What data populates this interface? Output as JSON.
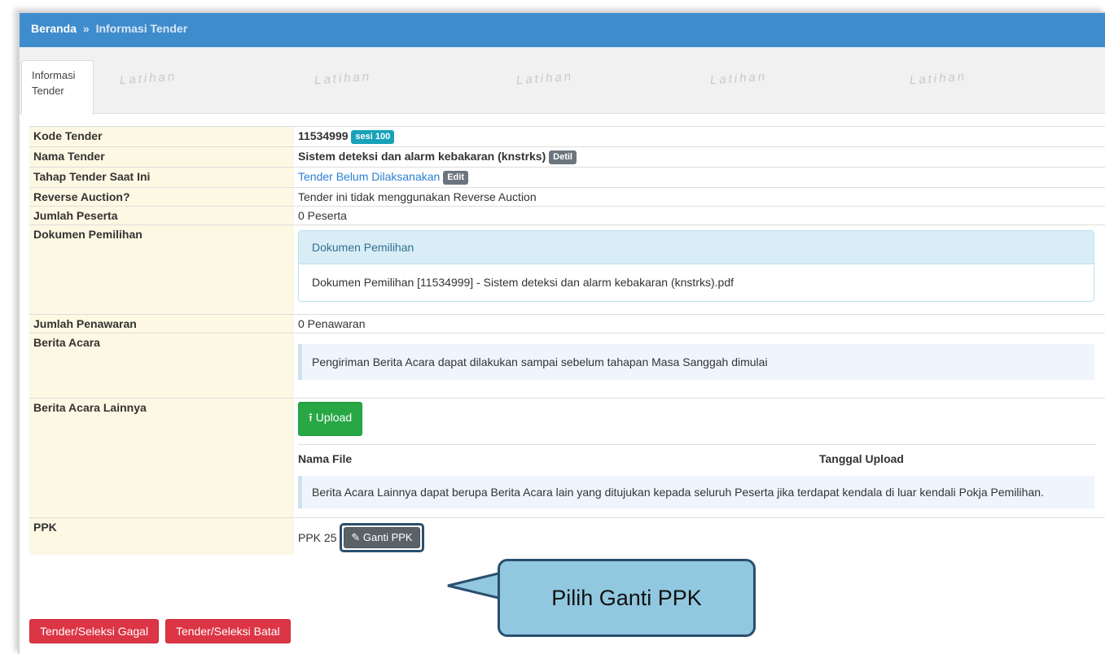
{
  "breadcrumb": {
    "home": "Beranda",
    "separator": "»",
    "current": "Informasi Tender"
  },
  "tabs": [
    {
      "label_line1": "Informasi",
      "label_line2": "Tender"
    }
  ],
  "watermark": "Latihan",
  "rows": {
    "kode": {
      "label": "Kode Tender",
      "value": "11534999",
      "badge": "sesi 100"
    },
    "nama": {
      "label": "Nama Tender",
      "value": "Sistem deteksi dan alarm kebakaran (knstrks)",
      "badge": "Detil"
    },
    "tahap": {
      "label": "Tahap Tender Saat Ini",
      "value": "Tender Belum Dilaksanakan",
      "badge": "Edit"
    },
    "reverse": {
      "label": "Reverse Auction?",
      "value": "Tender ini tidak menggunakan Reverse Auction"
    },
    "peserta": {
      "label": "Jumlah Peserta",
      "value": "0 Peserta"
    },
    "dokumen": {
      "label": "Dokumen Pemilihan",
      "panel_title": "Dokumen Pemilihan",
      "file": "Dokumen Pemilihan [11534999] - Sistem deteksi dan alarm kebakaran (knstrks).pdf"
    },
    "penawaran": {
      "label": "Jumlah Penawaran",
      "value": "0 Penawaran"
    },
    "berita": {
      "label": "Berita Acara",
      "note": "Pengiriman Berita Acara dapat dilakukan sampai sebelum tahapan Masa Sanggah dimulai"
    },
    "lainnya": {
      "label": "Berita Acara Lainnya",
      "upload_label": "Upload",
      "col_file": "Nama File",
      "col_date": "Tanggal Upload",
      "note": "Berita Acara Lainnya dapat berupa Berita Acara lain yang ditujukan kepada seluruh Peserta jika terdapat kendala di luar kendali Pokja Pemilihan."
    },
    "ppk": {
      "label": "PPK",
      "value": "PPK 25",
      "button": "Ganti PPK"
    }
  },
  "footer": {
    "gagal": "Tender/Seleksi Gagal",
    "batal": "Tender/Seleksi Batal"
  },
  "callout": "Pilih Ganti PPK",
  "colors": {
    "topbar": "#3f8ccd",
    "label_bg": "#fcf8e3",
    "badge_info": "#17a2b8",
    "success": "#28a745",
    "danger": "#dc3545",
    "callout_bg": "#91c8e0",
    "callout_border": "#2a4f6e"
  }
}
